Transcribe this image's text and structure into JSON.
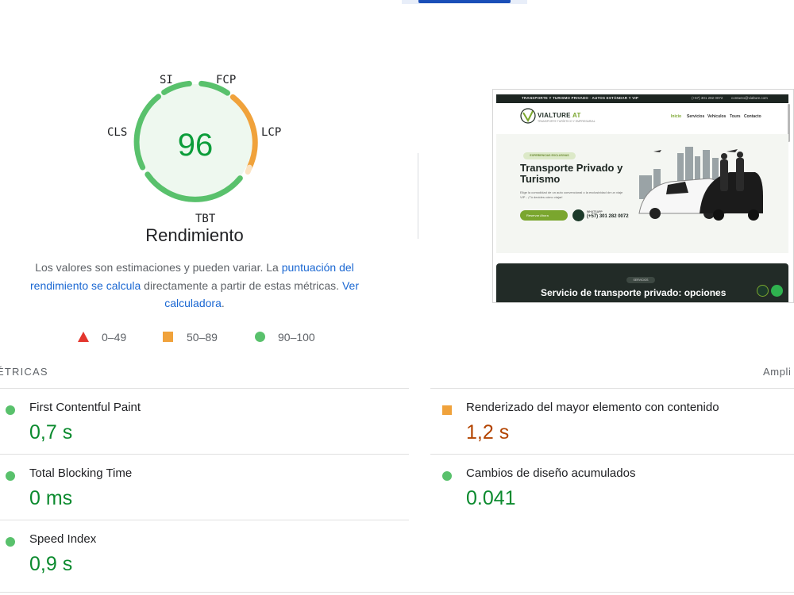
{
  "gauge": {
    "score": "96",
    "labels": {
      "si": "SI",
      "fcp": "FCP",
      "lcp": "LCP",
      "cls": "CLS",
      "tbt": "TBT"
    },
    "title": "Rendimiento",
    "colors": {
      "pass": "#59c16c",
      "average": "#f0a23b",
      "fail": "#e3362d"
    }
  },
  "description": {
    "text_1": "Los valores son estimaciones y pueden variar. La ",
    "link_1": "puntuación del rendimiento se calcula",
    "text_2": " directamente a partir de estas métricas. ",
    "link_2": "Ver calculadora",
    "text_3": "."
  },
  "legend": {
    "fail": "0–49",
    "average": "50–89",
    "pass": "90–100"
  },
  "metrics_section": {
    "header": "ÉTRICAS",
    "expand_link": "Ampli",
    "items": [
      {
        "name": "First Contentful Paint",
        "value": "0,7 s",
        "status": "pass"
      },
      {
        "name": "Renderizado del mayor elemento con contenido",
        "value": "1,2 s",
        "status": "average"
      },
      {
        "name": "Total Blocking Time",
        "value": "0 ms",
        "status": "pass"
      },
      {
        "name": "Cambios de diseño acumulados",
        "value": "0.041",
        "status": "pass"
      },
      {
        "name": "Speed Index",
        "value": "0,9 s",
        "status": "pass"
      }
    ]
  },
  "screenshot": {
    "topbar_text": "TRANSPORTE Y TURISMO PRIVADO · AUTOS ESTÁNDAR Y VIP",
    "topbar_phone": "(+57) 301 282 0072",
    "topbar_email": "contacto@vialture.com",
    "brand": "VIALTURE",
    "brand_suffix": "AT",
    "tagline": "TRANSPORTE TURÍSTICO Y EMPRESARIAL",
    "nav": [
      "Inicio",
      "Servicios",
      "Vehículos",
      "Tours",
      "Contacto"
    ],
    "hero_pill": "EXPERIENCIAS EXCLUSIVAS",
    "hero_title": "Transporte Privado y Turismo",
    "hero_desc": "Elige la comodidad de un auto convencional o la exclusividad de un viaje VIP - ¡Tú decides cómo viajar!",
    "hero_button": "Reservar Ahora",
    "whatsapp_label": "WHATSAPP",
    "whatsapp_number": "(+57) 301 282 0072",
    "section_pill": "SERVICIOS",
    "section_title": "Servicio de transporte privado: opciones"
  }
}
